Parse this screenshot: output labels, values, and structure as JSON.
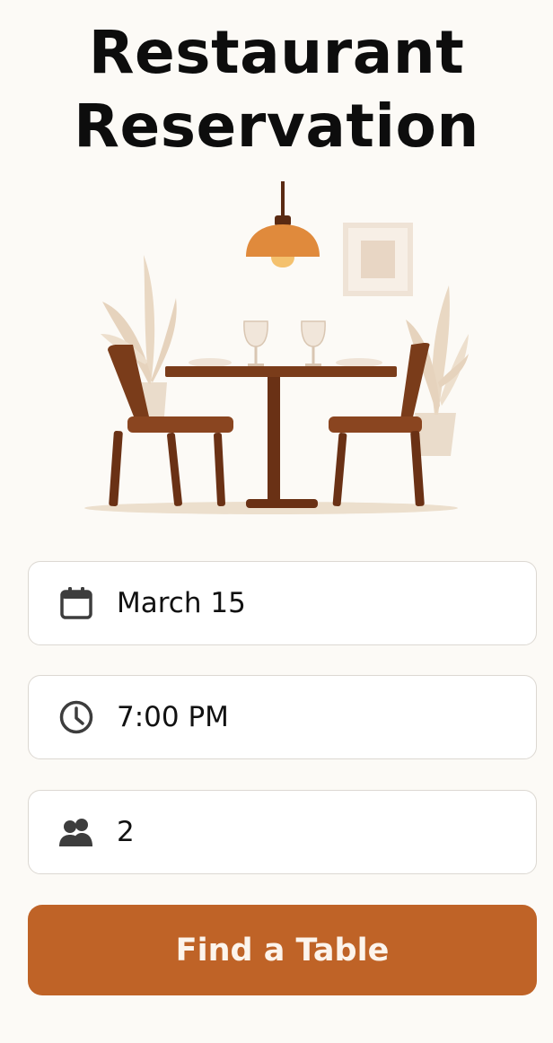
{
  "header": {
    "title_line1": "Restaurant",
    "title_line2": "Reservation"
  },
  "illustration": {
    "description_icon": "dining-table-illustration"
  },
  "form": {
    "date": {
      "value": "March 15",
      "icon": "calendar-icon"
    },
    "time": {
      "value": "7:00 PM",
      "icon": "clock-icon"
    },
    "party_size": {
      "value": "2",
      "icon": "people-icon"
    }
  },
  "actions": {
    "find_table_label": "Find a Table"
  },
  "colors": {
    "accent": "#bf6327",
    "wood": "#7a3c1a",
    "lamp": "#e08a3c",
    "background": "#fcfaf6"
  }
}
